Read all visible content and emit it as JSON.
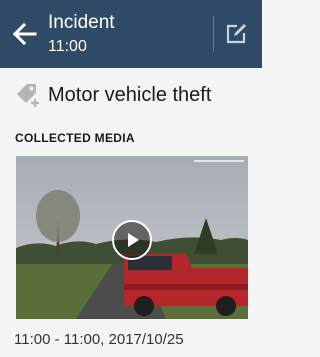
{
  "header": {
    "title": "Incident",
    "subtitle": "11:00",
    "back_icon": "arrow-left-icon",
    "edit_icon": "edit-icon",
    "background_color": "#2f4a66"
  },
  "incident": {
    "type_label": "Motor vehicle theft",
    "type_icon": "tag-add-icon"
  },
  "media_section": {
    "header": "COLLECTED MEDIA",
    "items": [
      {
        "kind": "video",
        "play_icon": "play-icon",
        "caption": "11:00 - 11:00, 2017/10/25"
      }
    ]
  }
}
